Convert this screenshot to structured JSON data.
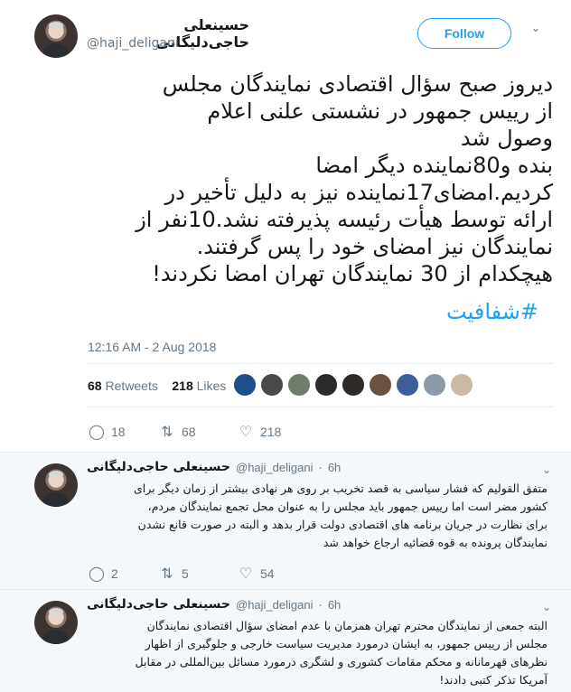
{
  "main_tweet": {
    "display_name": "حسینعلی حاجی‌دلیگانی",
    "handle": "@haji_deligani",
    "follow_label": "Follow",
    "body_lines": [
      "دیروز صبح سؤال اقتصادی نمایندگان مجلس",
      "از رییس جمهور در نشستی علنی اعلام",
      "وصول شد",
      "بنده و80نماینده دیگر امضا",
      "کردیم.امضای17نماینده نیز به دلیل تأخیر در",
      "ارائه توسط هیأت رئیسه پذیرفته نشد.10نفر از",
      "نمایندگان نیز امضای خود را پس گرفتند.",
      "هیچکدام از 30 نمایندگان تهران امضا نکردند!"
    ],
    "hashtag": "#شفافیت",
    "timestamp": "12:16 AM - 2 Aug 2018",
    "retweets_count": "68",
    "retweets_label": "Retweets",
    "likes_count": "218",
    "likes_label": "Likes",
    "actions": {
      "reply_count": "18",
      "retweet_count": "68",
      "like_count": "218"
    },
    "liker_colors": [
      "#1f4e8c",
      "#4a4a4a",
      "#6f7d6a",
      "#2a2a2a",
      "#2e2a26",
      "#6b5240",
      "#3a5f9a",
      "#8c9aa8",
      "#c9b9a5"
    ]
  },
  "replies": [
    {
      "display_name": "حسینعلی حاجی‌دلیگانی",
      "handle": "@haji_deligani",
      "time": "6h",
      "lines": [
        "متفق القولیم که فشار سیاسی به قصد تخریب بر روی هر نهادی بیشتر از زمان دیگر برای",
        "کشور مضر است اما رییس جمهور باید مجلس را به عنوان محل تجمع نمایندگان مردم،",
        "برای نظارت در جریان برنامه های اقتصادی دولت قرار بدهد و البته در صورت قانع نشدن",
        "نمایندگان پرونده به قوه قضائیه ارجاع خواهد شد"
      ],
      "reply_count": "2",
      "retweet_count": "5",
      "like_count": "54"
    },
    {
      "display_name": "حسینعلی حاجی‌دلیگانی",
      "handle": "@haji_deligani",
      "time": "6h",
      "lines": [
        "البته جمعی از نمایندگان محترم تهران همزمان با عدم امضای سؤال اقتصادی نمایندگان",
        "مجلس از رییس جمهور، به ایشان درمورد مدیریت سیاست خارجی و جلوگیری از اظهار",
        "نظرهای قهرمانانه و محکم مقامات کشوری و لشگری درمورد مسائل بین‌المللی در مقابل",
        "آمریکا تذکر کتبی دادند!"
      ]
    }
  ],
  "icons": {
    "reply": "reply-icon",
    "retweet": "retweet-icon",
    "like": "heart-icon",
    "caret": "chevron-down-icon"
  },
  "colors": {
    "accent": "#1da1f2",
    "muted": "#657786",
    "reply_bg": "#f5f8fa"
  }
}
